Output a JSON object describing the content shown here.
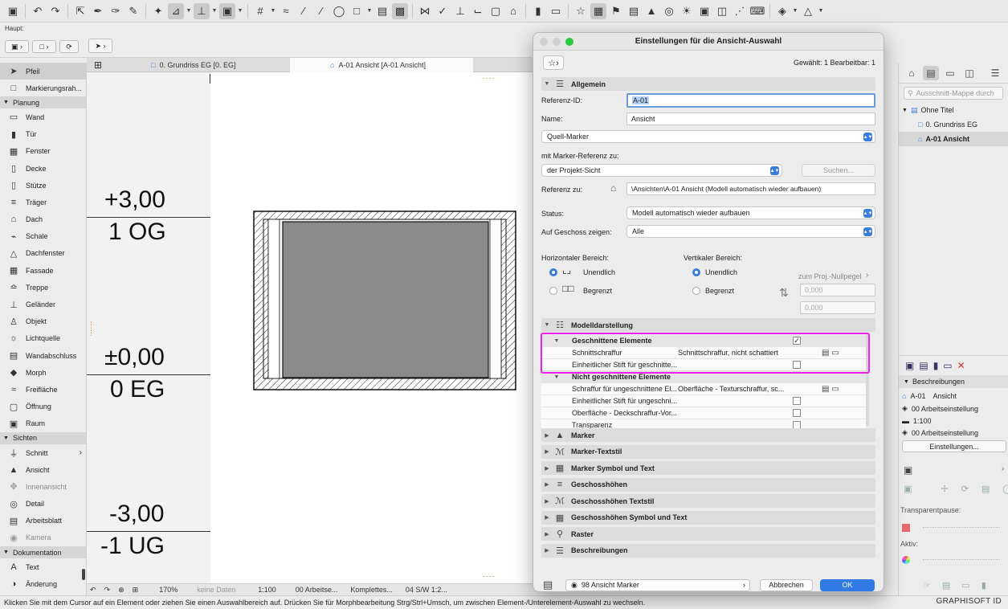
{
  "toolbar": {
    "icons": [
      "save-icon",
      "undo-icon",
      "redo-icon",
      "pick-up-icon",
      "eyedropper-icon",
      "inject-icon",
      "magic-wand-icon",
      "trace-icon",
      "guide-line-icon",
      "snap-icon",
      "gravity-icon",
      "grid-icon",
      "trim-icon",
      "adjust-icon",
      "drag-icon",
      "rotate-icon",
      "mirror-icon",
      "elevate-icon",
      "lock-icon",
      "layers-icon",
      "favorites-icon",
      "selection-icon",
      "flag-icon",
      "structure-icon",
      "renovation-icon",
      "3d-icon",
      "globe-icon",
      "render-icon",
      "measure-icon",
      "tag-icon",
      "layer-combo-icon",
      "attribute-icon"
    ]
  },
  "subbar": {
    "label": "Haupt:"
  },
  "toolbox": {
    "items": [
      {
        "type": "tool",
        "label": "Pfeil",
        "icon": "arrow-icon",
        "selected": true
      },
      {
        "type": "tool",
        "label": "Markierungsrah...",
        "icon": "marquee-icon"
      },
      {
        "type": "group",
        "label": "Planung"
      },
      {
        "type": "tool",
        "label": "Wand",
        "icon": "wall-icon"
      },
      {
        "type": "tool",
        "label": "Tür",
        "icon": "door-icon"
      },
      {
        "type": "tool",
        "label": "Fenster",
        "icon": "window-icon"
      },
      {
        "type": "tool",
        "label": "Decke",
        "icon": "slab-icon"
      },
      {
        "type": "tool",
        "label": "Stütze",
        "icon": "column-icon"
      },
      {
        "type": "tool",
        "label": "Träger",
        "icon": "beam-icon"
      },
      {
        "type": "tool",
        "label": "Dach",
        "icon": "roof-icon"
      },
      {
        "type": "tool",
        "label": "Schale",
        "icon": "shell-icon"
      },
      {
        "type": "tool",
        "label": "Dachfenster",
        "icon": "skylight-icon"
      },
      {
        "type": "tool",
        "label": "Fassade",
        "icon": "curtain-wall-icon"
      },
      {
        "type": "tool",
        "label": "Treppe",
        "icon": "stair-icon"
      },
      {
        "type": "tool",
        "label": "Geländer",
        "icon": "railing-icon"
      },
      {
        "type": "tool",
        "label": "Objekt",
        "icon": "object-icon"
      },
      {
        "type": "tool",
        "label": "Lichtquelle",
        "icon": "lamp-icon"
      },
      {
        "type": "tool",
        "label": "Wandabschluss",
        "icon": "wall-end-icon"
      },
      {
        "type": "tool",
        "label": "Morph",
        "icon": "morph-icon"
      },
      {
        "type": "tool",
        "label": "Freifläche",
        "icon": "mesh-icon"
      },
      {
        "type": "tool",
        "label": "Öffnung",
        "icon": "opening-icon"
      },
      {
        "type": "tool",
        "label": "Raum",
        "icon": "zone-icon"
      },
      {
        "type": "group",
        "label": "Sichten"
      },
      {
        "type": "tool",
        "label": "Schnitt",
        "icon": "section-icon",
        "chevron": true
      },
      {
        "type": "tool",
        "label": "Ansicht",
        "icon": "elevation-icon"
      },
      {
        "type": "tool",
        "label": "Innenansicht",
        "icon": "interior-elevation-icon",
        "dim": true
      },
      {
        "type": "tool",
        "label": "Detail",
        "icon": "detail-icon"
      },
      {
        "type": "tool",
        "label": "Arbeitsblatt",
        "icon": "worksheet-icon"
      },
      {
        "type": "tool",
        "label": "Kamera",
        "icon": "camera-icon",
        "dim": true
      },
      {
        "type": "group",
        "label": "Dokumentation"
      },
      {
        "type": "tool",
        "label": "Text",
        "icon": "text-icon"
      },
      {
        "type": "tool",
        "label": "Änderung",
        "icon": "change-icon"
      }
    ]
  },
  "tabs": [
    {
      "label": "0. Grundriss EG [0. EG]",
      "active": false
    },
    {
      "label": "A-01 Ansicht [A-01 Ansicht]",
      "active": true
    }
  ],
  "canvas": {
    "levels": [
      {
        "value": "+3,00",
        "name": "1 OG"
      },
      {
        "value": "±0,00",
        "name": "0 EG"
      },
      {
        "value": "-3,00",
        "name": "-1 UG"
      }
    ],
    "dashes": "----"
  },
  "statusrow": {
    "zoom": "170%",
    "nodata": "keine Daten",
    "scale": "1:100",
    "layer": "00 Arbeitse...",
    "model": "Komplettes...",
    "pen": "04 S/W 1:2..."
  },
  "hint": "Klicken Sie mit dem Cursor auf ein Element oder ziehen Sie einen Auswahlbereich auf. Drücken Sie für Morphbearbeitung Strg/Strl+Umsch, um zwischen Element-/Unterelement-Auswahl zu wechseln.",
  "brand": "GRAPHISOFT ID",
  "navigator": {
    "search_placeholder": "Ausschnitt-Mappe durch",
    "tree": [
      {
        "label": "Ohne Titel",
        "level": 0
      },
      {
        "label": "0. Grundriss EG",
        "level": 1
      },
      {
        "label": "A-01 Ansicht",
        "level": 1,
        "selected": true
      }
    ],
    "beschreibungen": "Beschreibungen",
    "props": [
      {
        "id": "A-01",
        "value": "Ansicht"
      },
      {
        "id": "",
        "value": "00 Arbeitseinstellung"
      },
      {
        "id": "",
        "value": "1:100"
      },
      {
        "id": "",
        "value": "00 Arbeitseinstellung"
      }
    ],
    "einstellungen": "Einstellungen...",
    "transparentpause": "Transparentpause:",
    "aktiv": "Aktiv:"
  },
  "dialog": {
    "title": "Einstellungen für die Ansicht-Auswahl",
    "selection_info": "Gewählt: 1 Bearbeitbar: 1",
    "allgemein": "Allgemein",
    "referenz_id_label": "Referenz-ID:",
    "referenz_id_value": "A-01",
    "name_label": "Name:",
    "name_value": "Ansicht",
    "quell_marker": "Quell-Marker",
    "marker_ref_label": "mit Marker-Referenz zu:",
    "projekt_sicht": "der Projekt-Sicht",
    "suchen": "Suchen...",
    "referenz_zu_label": "Referenz zu:",
    "referenz_zu_value": "\\Ansichten\\A-01 Ansicht (Modell automatisch wieder aufbauen)",
    "status_label": "Status:",
    "status_value": "Modell automatisch wieder aufbauen",
    "geschoss_label": "Auf Geschoss zeigen:",
    "geschoss_value": "Alle",
    "horiz_label": "Horizontaler Bereich:",
    "vert_label": "Vertikaler Bereich:",
    "unendlich": "Unendlich",
    "begrenzt": "Begrenzt",
    "nullpegel": "zum Proj.-Nullpegel",
    "val1": "0,000",
    "val2": "0,000",
    "modelldarstellung": "Modelldarstellung",
    "rows": [
      {
        "type": "grp",
        "label": "Geschnittene Elemente",
        "check": true
      },
      {
        "type": "row",
        "label": "Schnittschraffur",
        "value": "Schnittschraffur, nicht schattiert",
        "icons": true
      },
      {
        "type": "row",
        "label": "Einheitlicher Stift für geschnitte...",
        "value": "",
        "check": false
      },
      {
        "type": "grp",
        "label": "Nicht geschnittene Elemente"
      },
      {
        "type": "row",
        "label": "Schraffur für ungeschnittene El...",
        "value": "Oberfläche - Texturschraffur, sc...",
        "icons": true
      },
      {
        "type": "row",
        "label": "Einheitlicher Stift für ungeschni...",
        "value": "",
        "check": false
      },
      {
        "type": "row",
        "label": "Oberfläche - Deckschraffur-Vor...",
        "value": "",
        "check": false
      },
      {
        "type": "row",
        "label": "Transparenz",
        "value": "",
        "check": false
      }
    ],
    "collapsed_sections": [
      {
        "label": "Marker",
        "icon": "marker-icon"
      },
      {
        "label": "Marker-Textstil",
        "icon": "text-style-icon"
      },
      {
        "label": "Marker Symbol und Text",
        "icon": "symbol-icon"
      },
      {
        "label": "Geschosshöhen",
        "icon": "story-levels-icon"
      },
      {
        "label": "Geschosshöhen Textstil",
        "icon": "text-style-icon"
      },
      {
        "label": "Geschosshöhen Symbol und Text",
        "icon": "symbol-icon"
      },
      {
        "label": "Raster",
        "icon": "grid-marker-icon"
      },
      {
        "label": "Beschreibungen",
        "icon": "list-icon"
      }
    ],
    "footer_layer": "98 Ansicht Marker",
    "cancel": "Abbrechen",
    "ok": "OK"
  },
  "colors": {
    "accent": "#2f7ae5",
    "highlight": "#ee22ee"
  }
}
